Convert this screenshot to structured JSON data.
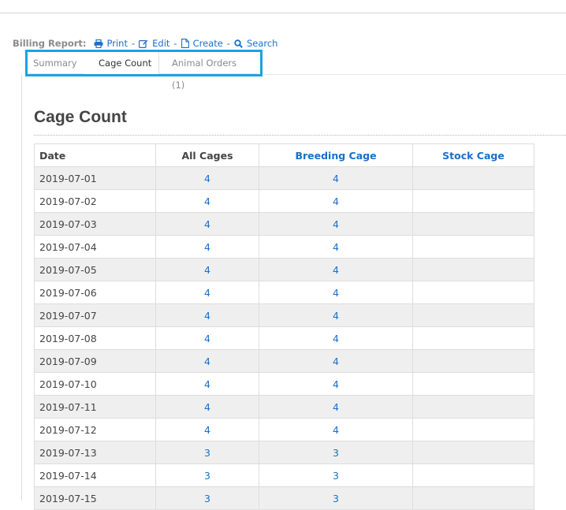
{
  "toolbar": {
    "label": "Billing Report:",
    "print": "Print",
    "edit": "Edit",
    "create": "Create",
    "search": "Search",
    "separator": "-"
  },
  "tabs": [
    {
      "label": "Summary",
      "active": false
    },
    {
      "label": "Cage Count",
      "active": true
    },
    {
      "label": "Animal Orders (1)",
      "active": false
    }
  ],
  "page": {
    "title": "Cage Count"
  },
  "table": {
    "headers": [
      "Date",
      "All Cages",
      "Breeding Cage",
      "Stock Cage"
    ],
    "rows": [
      {
        "date": "2019-07-01",
        "all": "4",
        "breeding": "4",
        "stock": ""
      },
      {
        "date": "2019-07-02",
        "all": "4",
        "breeding": "4",
        "stock": ""
      },
      {
        "date": "2019-07-03",
        "all": "4",
        "breeding": "4",
        "stock": ""
      },
      {
        "date": "2019-07-04",
        "all": "4",
        "breeding": "4",
        "stock": ""
      },
      {
        "date": "2019-07-05",
        "all": "4",
        "breeding": "4",
        "stock": ""
      },
      {
        "date": "2019-07-06",
        "all": "4",
        "breeding": "4",
        "stock": ""
      },
      {
        "date": "2019-07-07",
        "all": "4",
        "breeding": "4",
        "stock": ""
      },
      {
        "date": "2019-07-08",
        "all": "4",
        "breeding": "4",
        "stock": ""
      },
      {
        "date": "2019-07-09",
        "all": "4",
        "breeding": "4",
        "stock": ""
      },
      {
        "date": "2019-07-10",
        "all": "4",
        "breeding": "4",
        "stock": ""
      },
      {
        "date": "2019-07-11",
        "all": "4",
        "breeding": "4",
        "stock": ""
      },
      {
        "date": "2019-07-12",
        "all": "4",
        "breeding": "4",
        "stock": ""
      },
      {
        "date": "2019-07-13",
        "all": "3",
        "breeding": "3",
        "stock": ""
      },
      {
        "date": "2019-07-14",
        "all": "3",
        "breeding": "3",
        "stock": ""
      },
      {
        "date": "2019-07-15",
        "all": "3",
        "breeding": "3",
        "stock": ""
      }
    ]
  },
  "colors": {
    "link": "#1a6fc9",
    "highlight_border": "#1aa3e0",
    "row_stripe": "#efefef"
  }
}
